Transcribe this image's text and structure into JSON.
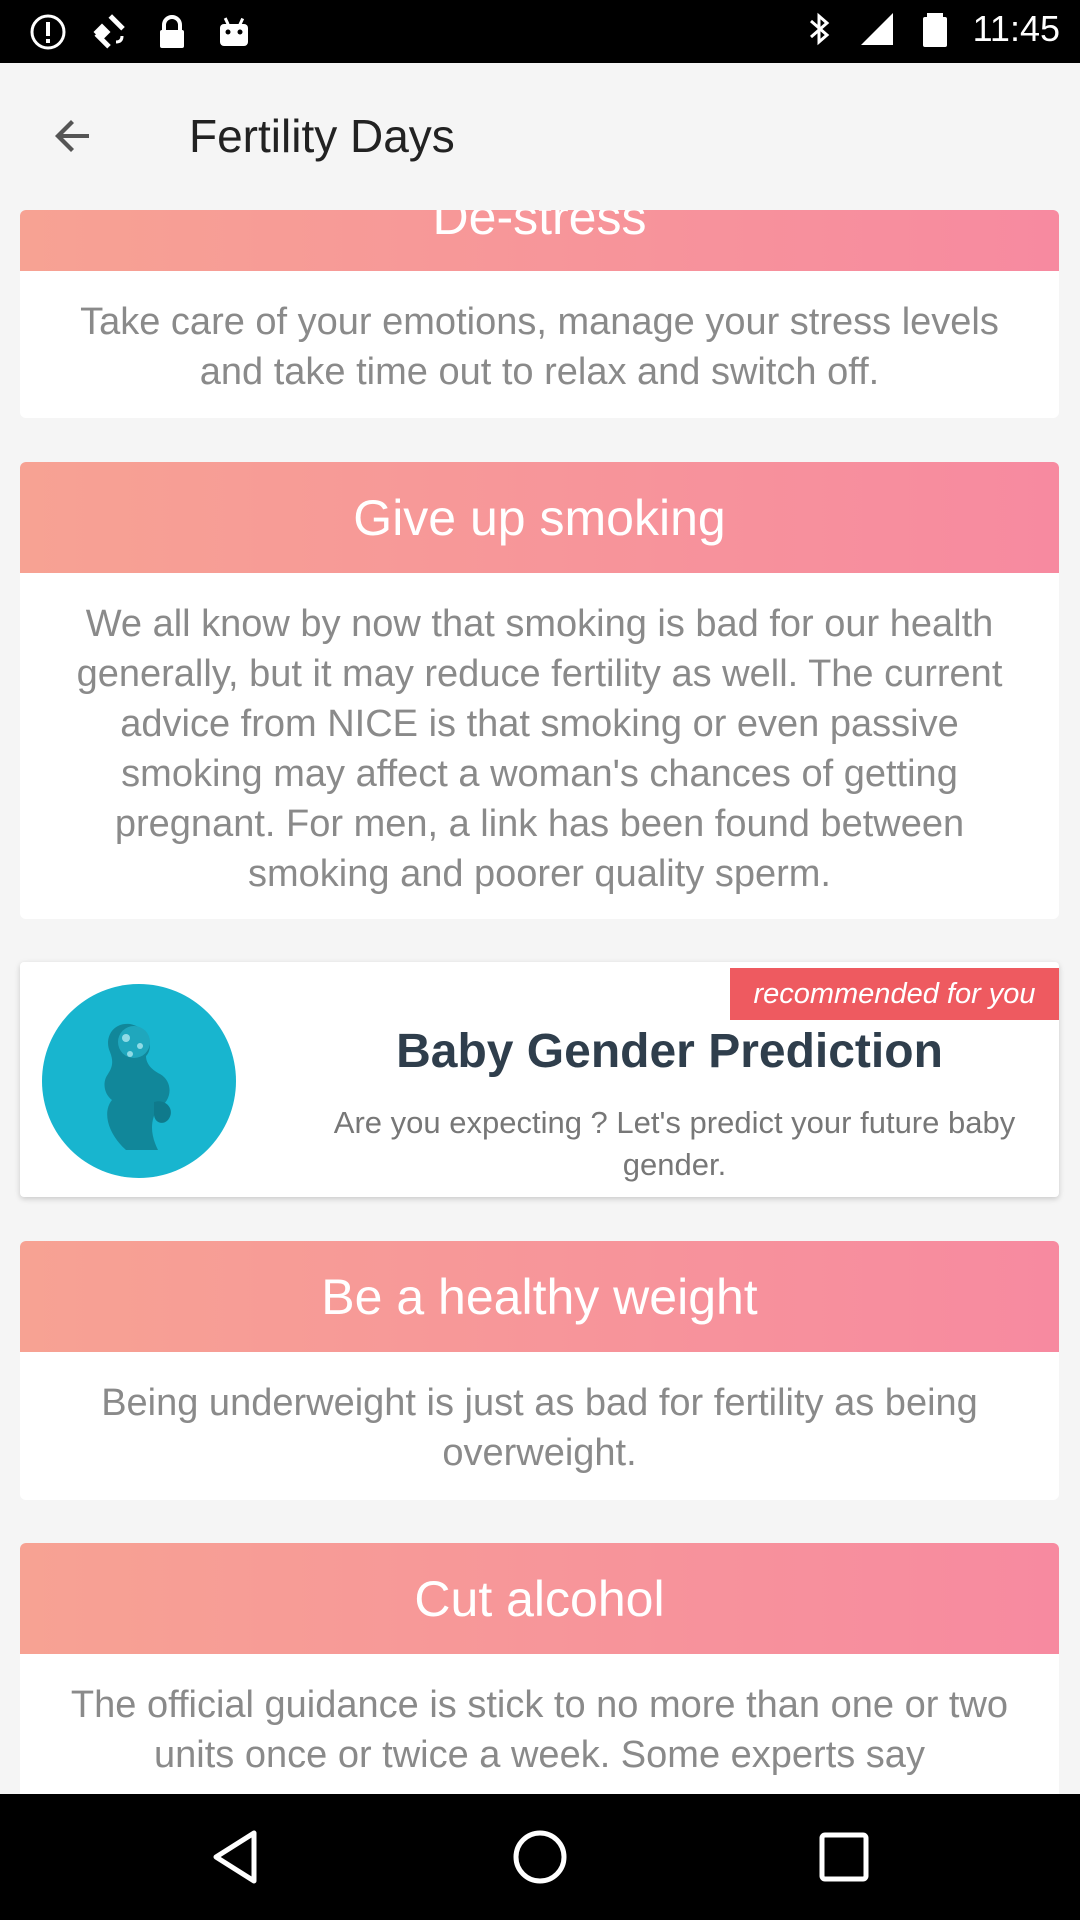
{
  "status_bar": {
    "time": "11:45",
    "left_icons": [
      "alert-icon",
      "fake-gps-icon",
      "lock-icon",
      "android-icon"
    ],
    "right_icons": [
      "bluetooth-icon",
      "signal-icon",
      "battery-icon"
    ]
  },
  "app_bar": {
    "title": "Fertility Days",
    "back_icon": "arrow-back-icon"
  },
  "tips": [
    {
      "title": "De-stress",
      "body": "Take care of your emotions, manage your stress levels and take time out to relax and switch off."
    },
    {
      "title": "Give up smoking",
      "body": "We all know by now that smoking is bad for our health generally, but it may reduce fertility as well. The current advice from NICE is that smoking or even passive smoking may affect a woman's chances of getting pregnant. For men, a link has been found between smoking and poorer quality sperm."
    },
    {
      "title": "Be a healthy weight",
      "body": "Being underweight is just as bad for fertility as being overweight."
    },
    {
      "title": "Cut alcohol",
      "body": "The official guidance is stick to no more than one or two units once or twice a week. Some experts say"
    }
  ],
  "promo": {
    "tag": "recommended for you",
    "title": "Baby Gender Prediction",
    "description": "Are you expecting ? Let's predict your future baby gender.",
    "logo_icon": "pregnant-silhouette-icon"
  },
  "colors": {
    "header_gradient_start": "#f7a293",
    "header_gradient_end": "#f78aa0",
    "tag_red": "#ee5a60",
    "logo_teal": "#18b5cf"
  },
  "nav_bar": [
    "back-triangle-icon",
    "home-circle-icon",
    "recents-square-icon"
  ]
}
